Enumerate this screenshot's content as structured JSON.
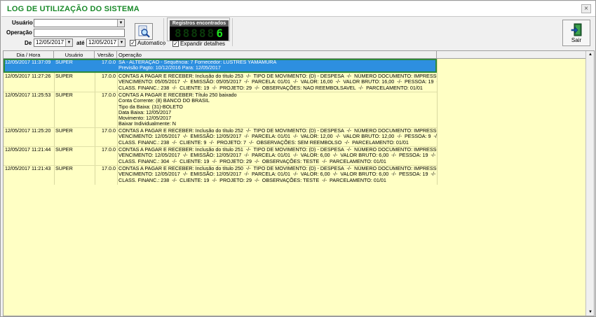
{
  "window": {
    "title": "LOG DE UTILIZAÇÃO DO SISTEMA",
    "close_glyph": "×"
  },
  "filters": {
    "usuario_label": "Usuário",
    "usuario_value": "",
    "operacao_label": "Operação",
    "operacao_value": "",
    "de_label": "De",
    "de_value": "12/05/2017",
    "ate_label": "até",
    "ate_value": "12/05/2017",
    "automatico_label": "Automatico",
    "automatico_checked": true
  },
  "counter": {
    "label": "Registros encontrados",
    "value": "6",
    "ghost": "88888"
  },
  "expand": {
    "label": "Expandir detalhes",
    "checked": true
  },
  "sair": {
    "label": "Sair"
  },
  "grid": {
    "headers": [
      "Dia / Hora",
      "Usuário",
      "Versão",
      "Operação"
    ],
    "rows": [
      {
        "date": "12/05/2017 11:37:09",
        "user": "SUPER",
        "version": "17.0.0",
        "op": "SA - ALTERAÇÃO - Sequência: 7 Fornecedor: LUSTRES YAMAMURA\nPrevisão Pagto: 10/12/2016 Para: 12/05/2017",
        "selected": true
      },
      {
        "date": "12/05/2017 11:27:26",
        "user": "SUPER",
        "version": "17.0.0",
        "op": "CONTAS A PAGAR E RECEBER: Inclusão do título 253  -/-  TIPO DE MOVIMENTO: (D) - DESPESA  -/-  NÚMERO DOCUMENTO: IMPRESSOS  -/-\nVENCIMENTO: 05/05/2017  -/-  EMISSÃO: 05/05/2017  -/-  PARCELA: 01/01  -/-  VALOR: 16,00  -/-  VALOR BRUTO: 16,00  -/-  PESSOA: 19  -/-\nCLASS. FINANC.: 238  -/-  CLIENTE: 19  -/-  PROJETO: 29  -/-  OBSERVAÇÕES: NAO REEMBOLSAVEL  -/-  PARCELAMENTO: 01/01",
        "selected": false
      },
      {
        "date": "12/05/2017 11:25:53",
        "user": "SUPER",
        "version": "17.0.0",
        "op": "CONTAS A PAGAR E RECEBER: Título 250 baixado\nConta Corrente: (8) BANCO DO BRASIL\nTipo da Baixa: (31)-BOLETO\nData Baixa: 12/05/2017\nMovimento: 12/05/2017\nBaixar Individualmente: N",
        "selected": false
      },
      {
        "date": "12/05/2017 11:25:20",
        "user": "SUPER",
        "version": "17.0.0",
        "op": "CONTAS A PAGAR E RECEBER: Inclusão do título 252  -/-  TIPO DE MOVIMENTO: (D) - DESPESA  -/-  NÚMERO DOCUMENTO: IMPRESSOS  -/-\nVENCIMENTO: 12/05/2017  -/-  EMISSÃO: 12/05/2017  -/-  PARCELA: 01/01  -/-  VALOR: 12,00  -/-  VALOR BRUTO: 12,00  -/-  PESSOA: 9  -/-\nCLASS. FINANC.: 238  -/-  CLIENTE: 9  -/-  PROJETO: 7  -/-  OBSERVAÇÕES: SEM REEMBOLSO  -/-  PARCELAMENTO: 01/01",
        "selected": false
      },
      {
        "date": "12/05/2017 11:21:44",
        "user": "SUPER",
        "version": "17.0.0",
        "op": "CONTAS A PAGAR E RECEBER: Inclusão do título 251  -/-  TIPO DE MOVIMENTO: (D) - DESPESA  -/-  NÚMERO DOCUMENTO: IMPRESSOS  -/-\nVENCIMENTO: 12/05/2017  -/-  EMISSÃO: 12/05/2017  -/-  PARCELA: 01/01  -/-  VALOR: 6,00  -/-  VALOR BRUTO: 6,00  -/-  PESSOA: 19  -/-\nCLASS. FINANC.: 304  -/-  CLIENTE: 19  -/-  PROJETO: 29  -/-  OBSERVAÇÕES: TESTE  -/-  PARCELAMENTO: 01/01",
        "selected": false
      },
      {
        "date": "12/05/2017 11:21:43",
        "user": "SUPER",
        "version": "17.0.0",
        "op": "CONTAS A PAGAR E RECEBER: Inclusão do título 250  -/-  TIPO DE MOVIMENTO: (D) - DESPESA  -/-  NÚMERO DOCUMENTO: IMPRESSOS  -/-\nVENCIMENTO: 12/05/2017  -/-  EMISSÃO: 12/05/2017  -/-  PARCELA: 01/01  -/-  VALOR: 6,00  -/-  VALOR BRUTO: 6,00  -/-  PESSOA: 19  -/-\nCLASS. FINANC.: 238  -/-  CLIENTE: 19  -/-  PROJETO: 29  -/-  OBSERVAÇÕES: TESTE  -/-  PARCELAMENTO: 01/01",
        "selected": false
      }
    ]
  },
  "colors": {
    "title_green": "#1a8a2a",
    "grid_background": "#ffffc4",
    "selection_blue": "#2d8fe0",
    "selection_frame": "#2d8a3a",
    "lcd_green": "#1ee01e"
  },
  "icons": {
    "search": "magnifier-document-icon",
    "exit": "exit-door-icon",
    "dropdown": "chevron-down-icon",
    "scroll_up": "scroll-up-arrow-icon",
    "scroll_down": "scroll-down-arrow-icon"
  }
}
